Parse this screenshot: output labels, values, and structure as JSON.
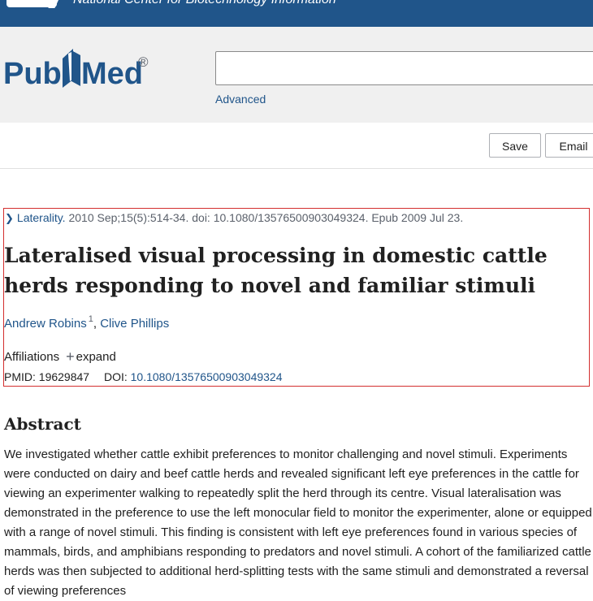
{
  "ncbi": {
    "title": "National Center for Biotechnology Information"
  },
  "logo": {
    "text_pub": "Pub",
    "text_med": "Med",
    "registered": "®"
  },
  "search": {
    "value": "",
    "advanced_label": "Advanced"
  },
  "actions": {
    "save_label": "Save",
    "email_label": "Email"
  },
  "article": {
    "journal": "Laterality.",
    "citation_rest": " 2010 Sep;15(5):514-34. doi: 10.1080/13576500903049324. Epub 2009 Jul 23.",
    "title": "Lateralised visual processing in domestic cattle herds responding to novel and familiar stimuli",
    "authors": [
      {
        "name": "Andrew Robins",
        "affiliation_ref": "1"
      },
      {
        "name": "Clive Phillips"
      }
    ],
    "author_separator": ",",
    "affiliations_label": "Affiliations",
    "expand_label": "expand",
    "pmid_label": "PMID:",
    "pmid": "19629847",
    "doi_label": "DOI:",
    "doi": "10.1080/13576500903049324"
  },
  "abstract": {
    "heading": "Abstract",
    "text": "We investigated whether cattle exhibit preferences to monitor challenging and novel stimuli. Experiments were conducted on dairy and beef cattle herds and revealed significant left eye preferences in the cattle for viewing an experimenter walking to repeatedly split the herd through its centre. Visual lateralisation was demonstrated in the preference to use the left monocular field to monitor the experimenter, alone or equipped with a range of novel stimuli. This finding is consistent with left eye preferences found in various species of mammals, birds, and amphibians responding to predators and novel stimuli. A cohort of the familiarized cattle herds was then subjected to additional herd-splitting tests with the same stimuli and demonstrated a reversal of viewing preferences"
  },
  "colors": {
    "ncbi_blue": "#20558a",
    "link": "#20558a",
    "highlight_border": "#d32f2f"
  }
}
